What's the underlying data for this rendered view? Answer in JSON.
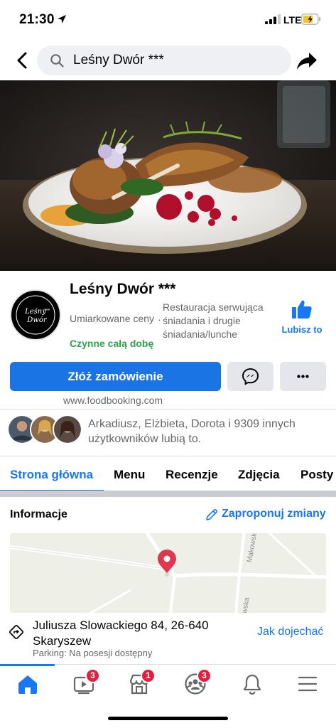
{
  "status_bar": {
    "time": "21:30",
    "network": "LTE"
  },
  "search": {
    "query": "Leśny Dwór ***"
  },
  "page": {
    "name": "Leśny Dwór ***",
    "avatar_text": "Leśny Dwór",
    "price_range": "Umiarkowane ceny",
    "category_separator": "·",
    "category": "Restauracja serwująca śniadania i drugie śniadania/lunche",
    "open_status": "Czynne całą dobę",
    "like_label": "Lubisz to",
    "website": "www.foodbooking.com"
  },
  "actions": {
    "order_label": "Złóż zamówienie"
  },
  "friends": {
    "text": "Arkadiusz, Elżbieta, Dorota i 9309 innych użytkowników lubią to."
  },
  "tabs": [
    "Strona główna",
    "Menu",
    "Recenzje",
    "Zdjęcia",
    "Posty"
  ],
  "info": {
    "title": "Informacje",
    "suggest_label": "Zaproponuj zmiany",
    "map_streets": [
      "Makowska",
      "wska"
    ],
    "address": "Juliusza Slowackiego 84, 26-640 Skaryszew",
    "parking": "Parking: Na posesji dostępny",
    "directions_label": "Jak dojechać"
  },
  "bottom_nav": {
    "items": [
      {
        "icon": "home-icon",
        "badge": ""
      },
      {
        "icon": "watch-icon",
        "badge": "3"
      },
      {
        "icon": "marketplace-icon",
        "badge": "1"
      },
      {
        "icon": "groups-icon",
        "badge": "3"
      },
      {
        "icon": "bell-icon",
        "badge": ""
      },
      {
        "icon": "menu-icon",
        "badge": ""
      }
    ]
  },
  "colors": {
    "accent": "#1877f2",
    "primary_button": "#1b74e4",
    "open_green": "#31a24c",
    "badge_red": "#e41e3f"
  }
}
